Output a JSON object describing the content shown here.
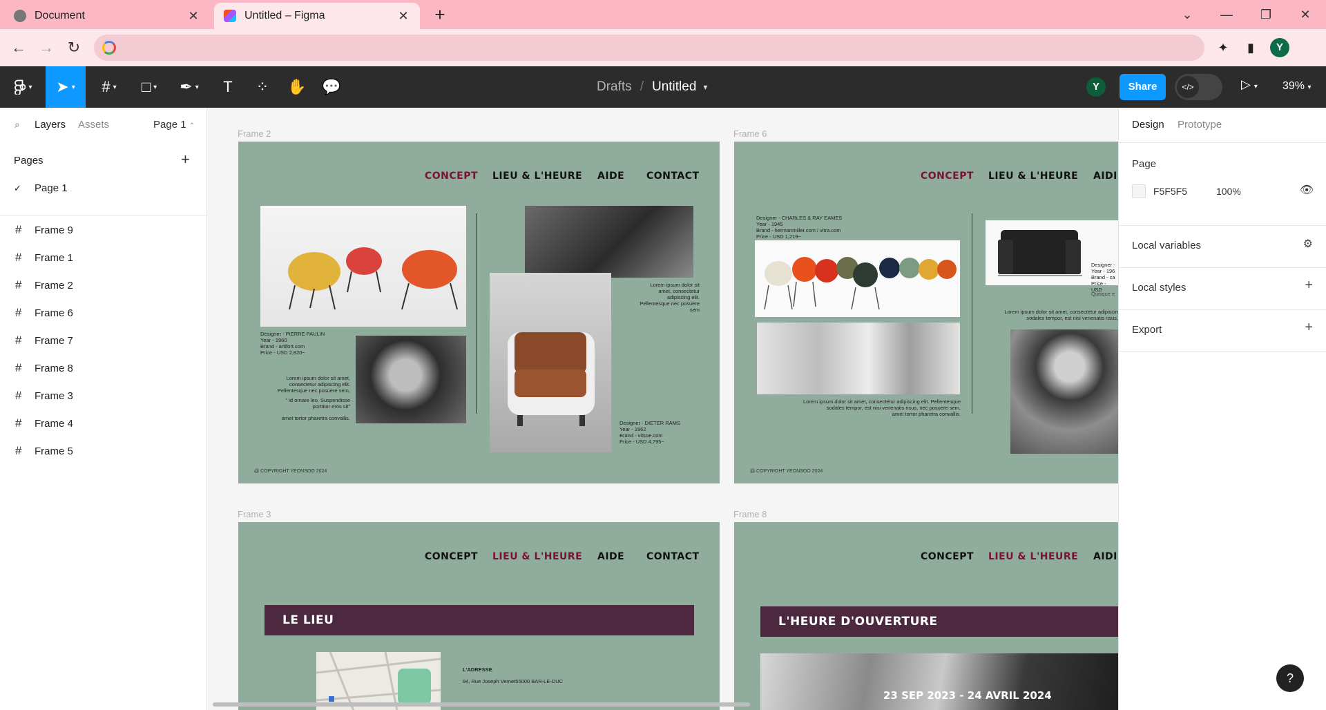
{
  "browser": {
    "tabs": [
      {
        "title": "Document",
        "close": "✕"
      },
      {
        "title": "Untitled – Figma",
        "close": "✕"
      }
    ],
    "new_tab": "+",
    "window_controls": [
      "⌄",
      "—",
      "❐",
      "✕"
    ],
    "profile_initial": "Y"
  },
  "figma": {
    "breadcrumb": {
      "project": "Drafts",
      "separator": "/",
      "file": "Untitled"
    },
    "avatar_initial": "Y",
    "share_label": "Share",
    "zoom": "39%"
  },
  "left_panel": {
    "tabs": [
      "Layers",
      "Assets"
    ],
    "page_selector": "Page 1",
    "pages_heading": "Pages",
    "add": "+",
    "pages": [
      "Page 1"
    ],
    "layers": [
      "Frame 9",
      "Frame 1",
      "Frame 2",
      "Frame 6",
      "Frame 7",
      "Frame 8",
      "Frame 3",
      "Frame 4",
      "Frame 5"
    ]
  },
  "canvas": {
    "frame2": {
      "label": "Frame 2",
      "nav": [
        "CONCEPT",
        "LIEU & L'HEURE",
        "AIDE",
        "CONTACT"
      ],
      "caption1": "Designer - PIERRE PAULIN\nYear - 1960\nBrand - artifort.com\nPrice - USD 2,820~",
      "body1": "Lorem ipsum dolor sit amet,\nconsectetur adipiscing elit.\nPellentesque nec posuere sem,",
      "quote": "\" id ornare leo. Suspendisse\nporttitor eros sit\"",
      "body2": "amet tortor pharetra convallis.",
      "body3": "Lorem ipsum dolor sit\namet, consectetur\nadipiscing elit.\nPellentesque nec posuere\nsem",
      "caption2": "Designer - DIETER RAMS\nYear - 1962\nBrand - vitsoe.com\nPrice - USD 4,795~",
      "copyright": "@ COPYRIGHT YEONSOO 2024"
    },
    "frame6": {
      "label": "Frame 6",
      "nav": [
        "CONCEPT",
        "LIEU & L'HEURE",
        "AIDI"
      ],
      "caption1": "Designer - CHARLES & RAY EAMES\nYear - 1945\nBrand - hermanmiller.com / vitra.com\nPrice - USD 1,219~",
      "body1": "Lorem ipsum dolor sit amet, consectetur adipiscing elit. Pellentesque\nsodales tempor, est nisi venenatis risus, nec posuere sem,\namet tortor pharetra convallis.",
      "caption2": "Designer -\nYear - 196\nBrand - ca\nPrice - USD",
      "quisque": "Quisque e",
      "body2": "Lorem ipsum dolor sit amet, consectetur adipiscin\nsodales tempor, est nisi venenatis risus,",
      "copyright": "@ COPYRIGHT YEONSOO 2024"
    },
    "frame3": {
      "label": "Frame 3",
      "nav": [
        "CONCEPT",
        "LIEU & L'HEURE",
        "AIDE",
        "CONTACT"
      ],
      "banner": "LE LIEU",
      "address_title": "L'ADRESSE",
      "address": "94, Rue Joseph Vernet55000 BAR-LE-DUC"
    },
    "frame8": {
      "label": "Frame 8",
      "nav": [
        "CONCEPT",
        "LIEU & L'HEURE",
        "AIDI"
      ],
      "banner": "L'HEURE D'OUVERTURE",
      "dates": "23 SEP 2023 - 24 AVRIL 2024"
    }
  },
  "right_panel": {
    "tabs": [
      "Design",
      "Prototype"
    ],
    "page_heading": "Page",
    "bg_color": "F5F5F5",
    "bg_opacity": "100%",
    "sections": [
      "Local variables",
      "Local styles",
      "Export"
    ]
  },
  "help": "?"
}
